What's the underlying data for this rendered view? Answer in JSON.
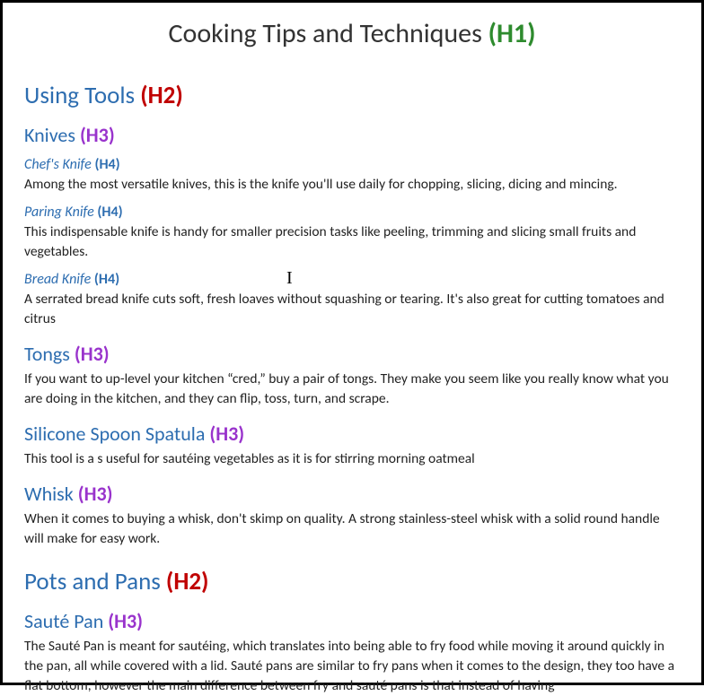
{
  "h1": {
    "text": "Cooking Tips and Techniques",
    "tag": "(H1)"
  },
  "sections": [
    {
      "h2": {
        "text": "Using Tools",
        "tag": "(H2)"
      },
      "h3s": [
        {
          "text": "Knives",
          "tag": "(H3)",
          "h4s": [
            {
              "text": "Chef's Knife",
              "tag": "(H4)",
              "body": "Among the most versatile knives, this is the knife you'll use daily for chopping, slicing, dicing and mincing."
            },
            {
              "text": "Paring Knife",
              "tag": "(H4)",
              "body": "This indispensable knife is handy for smaller precision tasks like peeling, trimming and slicing small fruits and vegetables."
            },
            {
              "text": "Bread Knife",
              "tag": "(H4)",
              "body": "A serrated bread knife cuts soft, fresh loaves without squashing or tearing. It's also great for cutting tomatoes and citrus"
            }
          ]
        },
        {
          "text": "Tongs",
          "tag": "(H3)",
          "body": "If you want to up-level your kitchen “cred,” buy a pair of tongs. They make you seem like you really know what you are doing in the kitchen, and they can flip, toss, turn, and scrape."
        },
        {
          "text": "Silicone Spoon Spatula",
          "tag": "(H3)",
          "body": "This tool is a s useful for sautéing vegetables as it is for stirring morning oatmeal"
        },
        {
          "text": "Whisk",
          "tag": "(H3)",
          "body": "When it comes to buying a whisk, don't skimp on quality. A strong stainless-steel whisk with a solid round handle will make for easy work."
        }
      ]
    },
    {
      "h2": {
        "text": "Pots and Pans",
        "tag": "(H2)"
      },
      "h3s": [
        {
          "text": "Sauté Pan",
          "tag": "(H3)",
          "body": "The Sauté Pan is meant for sautéing, which translates into being able to fry food while moving it around quickly in the pan, all while covered with a lid. Sauté pans are similar to fry pans when it comes to the design, they too have a flat bottom, however the main difference between fry and sauté pans is that instead of having"
        }
      ]
    }
  ]
}
